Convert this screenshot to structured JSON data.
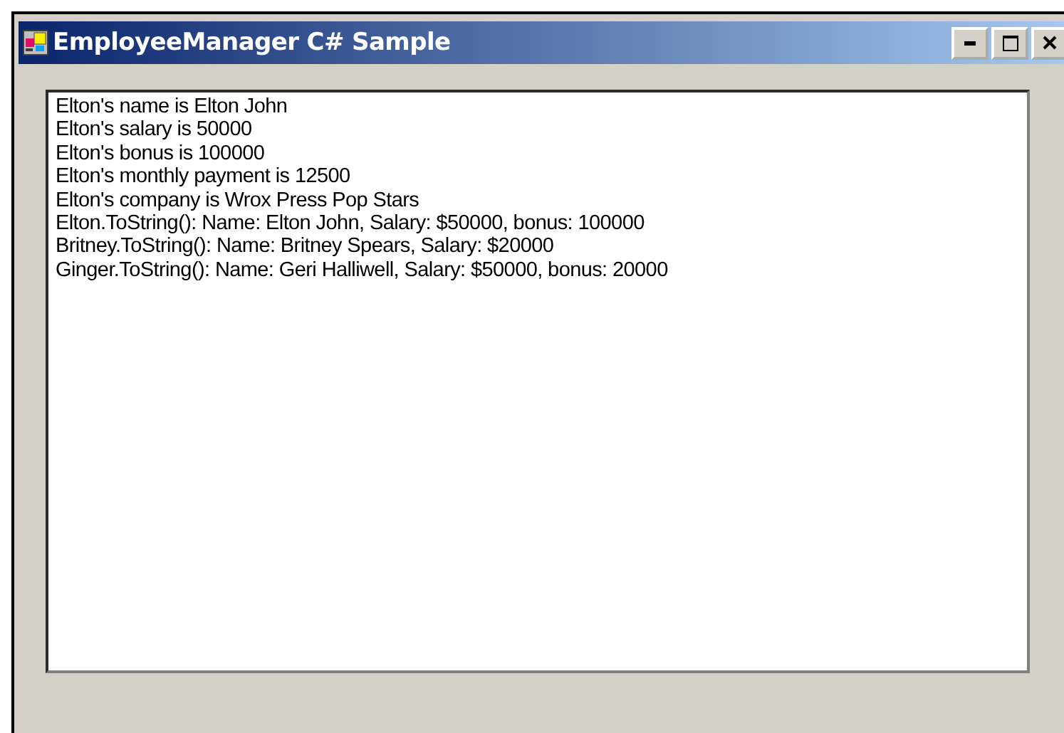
{
  "window": {
    "title": "EmployeeManager C# Sample"
  },
  "output_list": {
    "lines": [
      "Elton's name is Elton John",
      "Elton's salary is 50000",
      "Elton's bonus is 100000",
      "Elton's monthly payment is 12500",
      "Elton's company is Wrox Press Pop Stars",
      "Elton.ToString(): Name: Elton John, Salary: $50000, bonus: 100000",
      "Britney.ToString(): Name: Britney Spears, Salary: $20000",
      "Ginger.ToString(): Name: Geri Halliwell, Salary: $50000, bonus: 20000"
    ]
  }
}
